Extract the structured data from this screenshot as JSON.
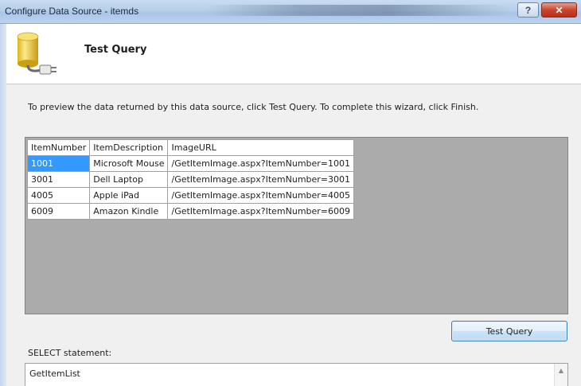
{
  "window": {
    "title": "Configure Data Source - itemds",
    "help_label": "?",
    "close_label": "✕"
  },
  "header": {
    "title": "Test Query",
    "icon": "database-connector-icon"
  },
  "instructions": "To preview the data returned by this data source, click Test Query. To complete this wizard, click Finish.",
  "grid": {
    "columns": [
      "ItemNumber",
      "ItemDescription",
      "ImageURL"
    ],
    "rows": [
      [
        "1001",
        "Microsoft Mouse",
        "/GetItemImage.aspx?ItemNumber=1001"
      ],
      [
        "3001",
        "Dell Laptop",
        "/GetItemImage.aspx?ItemNumber=3001"
      ],
      [
        "4005",
        "Apple iPad",
        "/GetItemImage.aspx?ItemNumber=4005"
      ],
      [
        "6009",
        "Amazon Kindle",
        "/GetItemImage.aspx?ItemNumber=6009"
      ]
    ],
    "selected_cell": "1001"
  },
  "buttons": {
    "test_query": "Test Query"
  },
  "select_statement": {
    "label": "SELECT statement:",
    "value": "GetItemList"
  },
  "colors": {
    "selection": "#3399ff",
    "grid_background": "#ababab",
    "close_button": "#c8462e"
  }
}
